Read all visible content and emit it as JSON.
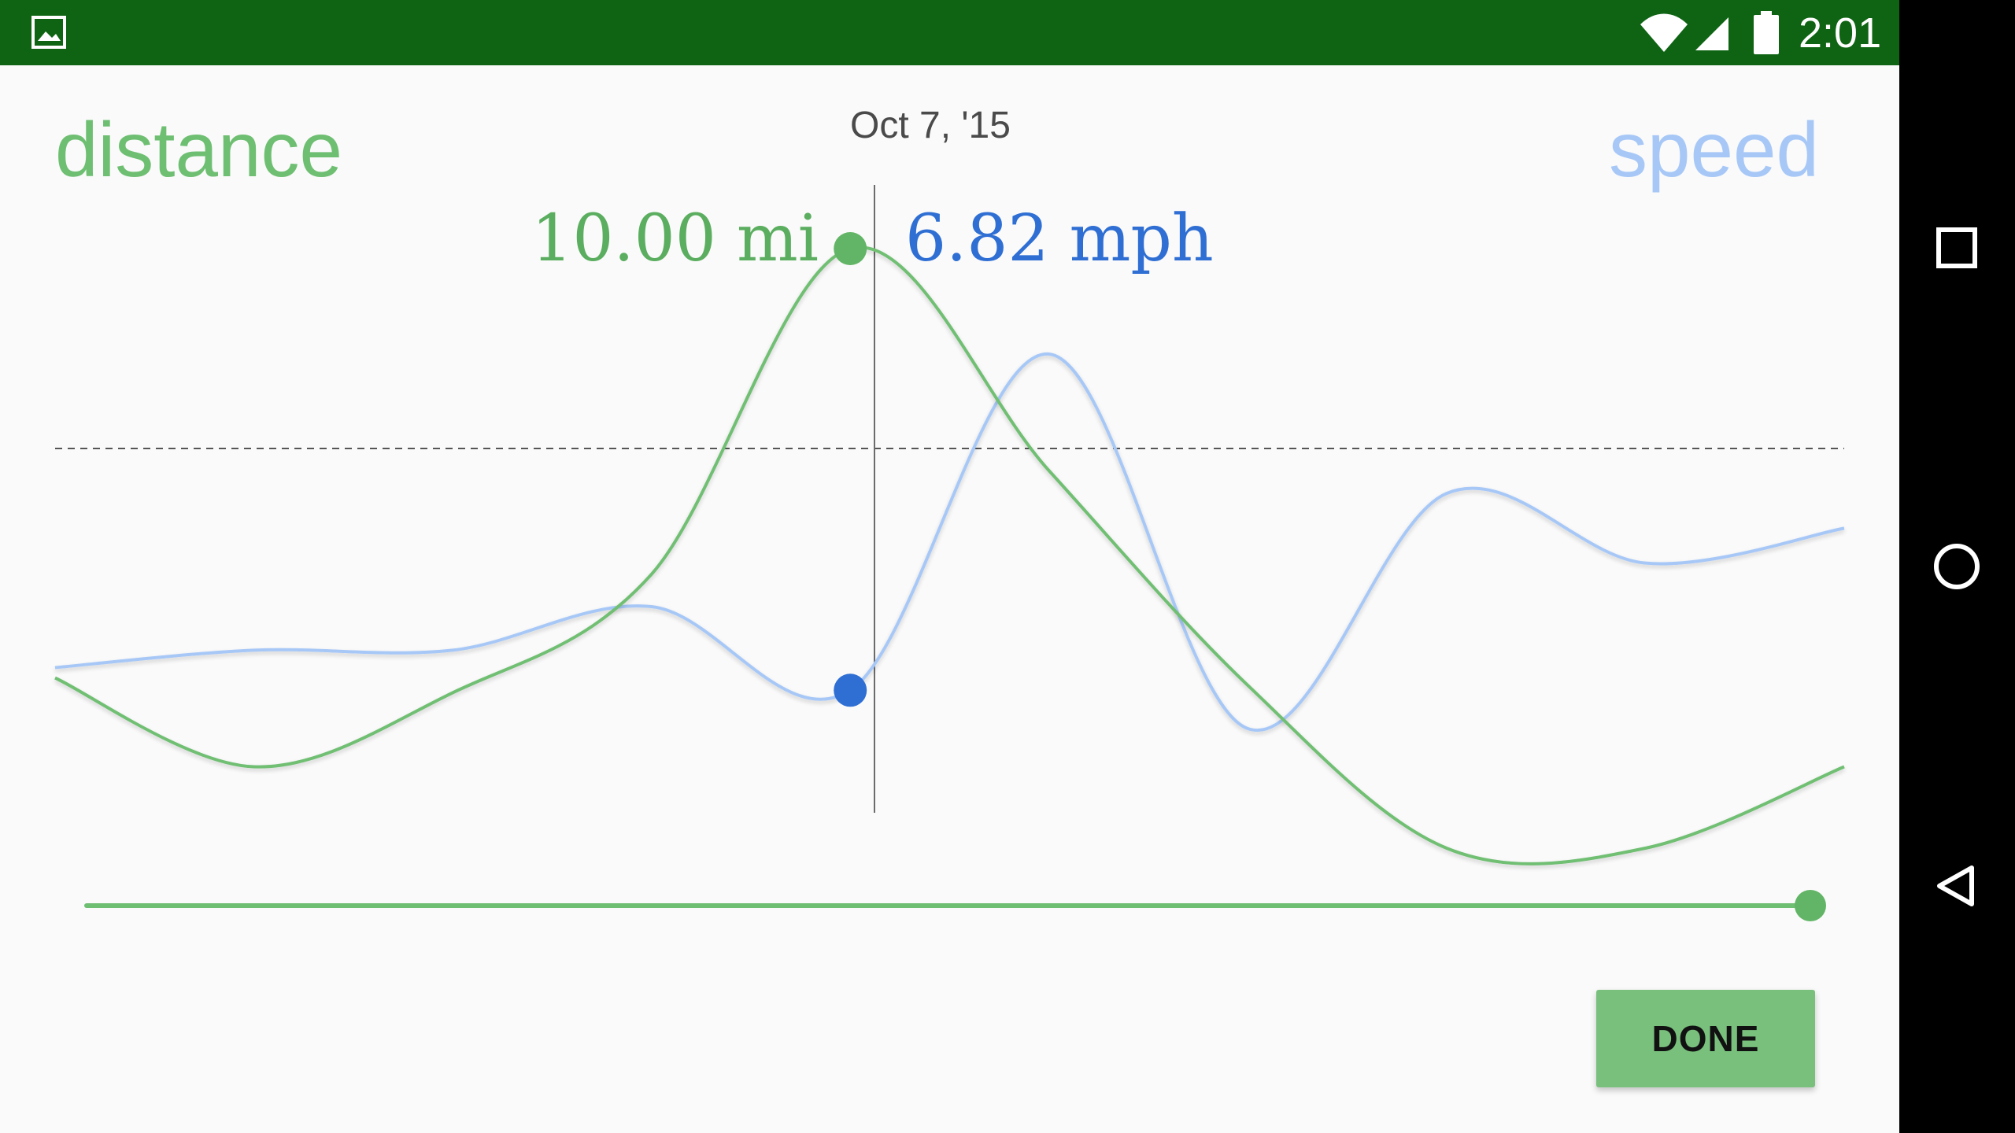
{
  "status_bar": {
    "time": "2:01",
    "icons": [
      "image-icon",
      "wifi-icon",
      "cellular-signal-icon",
      "battery-icon"
    ],
    "background_color": "#0f6414"
  },
  "navigation_bar": {
    "icons": [
      "recents-square-icon",
      "home-circle-icon",
      "back-triangle-icon"
    ]
  },
  "chart": {
    "left_series_label": "distance",
    "right_series_label": "speed",
    "selected_date": "Oct 7, '15",
    "distance_value": "10.00 mi",
    "speed_value": "6.82 mph",
    "distance_color": "#6fbf73",
    "speed_color": "#a7c8f7",
    "distance_marker_color": "#62b566",
    "speed_marker_color": "#2f6fd4"
  },
  "chart_data": {
    "type": "line",
    "series": [
      {
        "name": "distance",
        "values": [
          4.2,
          3.0,
          4.0,
          5.6,
          10.0,
          7.0,
          4.1,
          1.9,
          1.9,
          3.0
        ]
      },
      {
        "name": "speed",
        "values": [
          6.95,
          7.05,
          7.05,
          7.3,
          6.82,
          8.75,
          6.6,
          7.95,
          7.55,
          7.75
        ]
      }
    ],
    "selected_index": 4,
    "reference_line": "dashed",
    "grid": false
  },
  "range_slider": {
    "value": 1.0,
    "color": "#6fbf73"
  },
  "actions": {
    "done_label": "DONE"
  }
}
